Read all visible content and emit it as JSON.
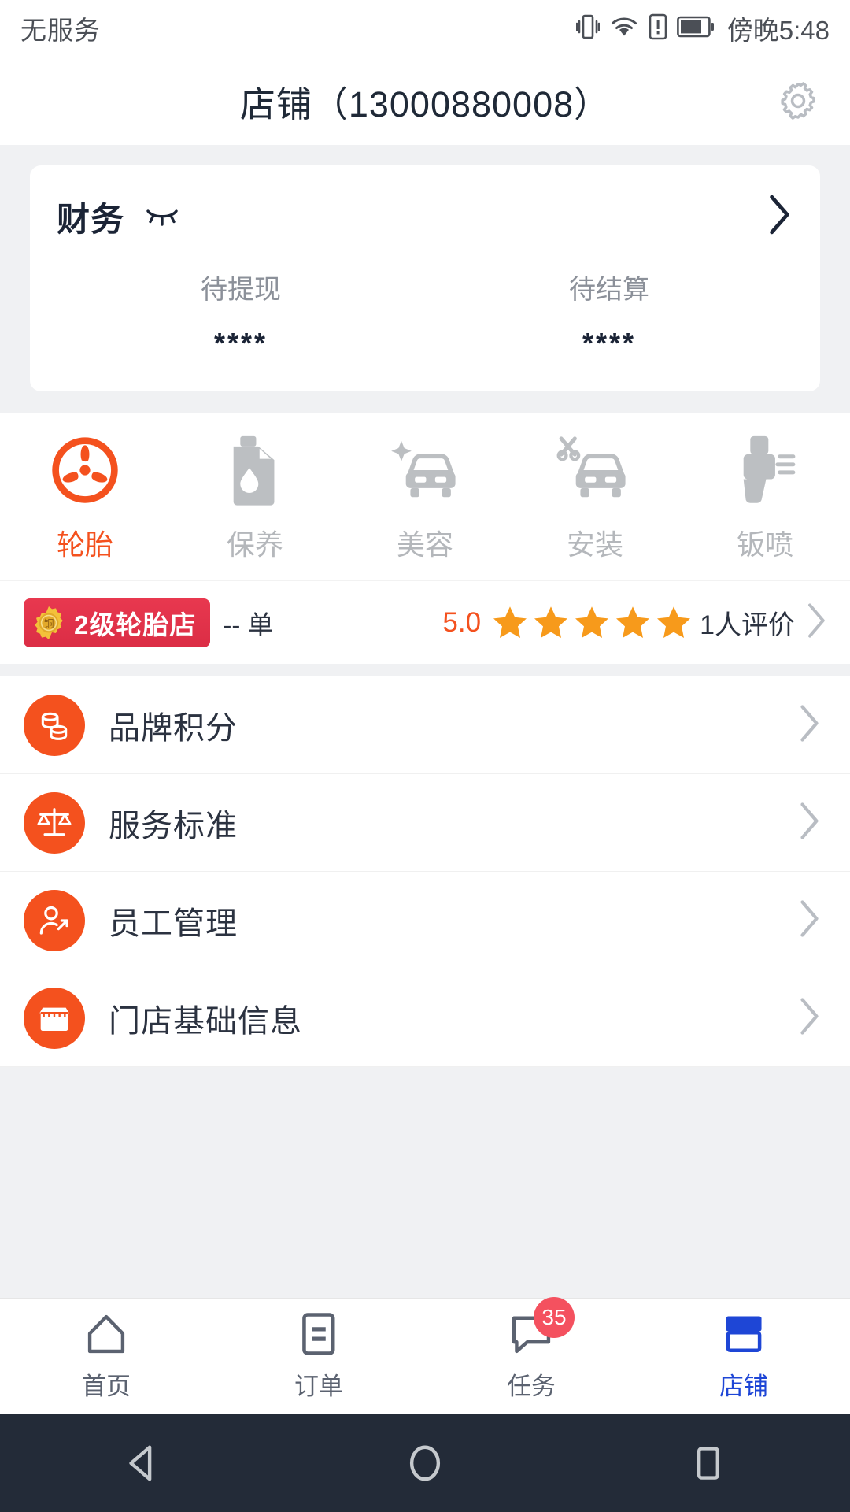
{
  "status_bar": {
    "carrier": "无服务",
    "time": "傍晚5:48",
    "icons": [
      "vibrate-icon",
      "wifi-icon",
      "sim-alert-icon",
      "battery-icon"
    ]
  },
  "header": {
    "title": "店铺（13000880008）",
    "settings_icon": "gear-icon"
  },
  "finance": {
    "title": "财务",
    "visibility_icon": "eye-closed-icon",
    "chevron_icon": "chevron-right-icon",
    "columns": [
      {
        "label": "待提现",
        "value": "****"
      },
      {
        "label": "待结算",
        "value": "****"
      }
    ]
  },
  "categories": [
    {
      "label": "轮胎",
      "icon": "tire-icon",
      "active": true
    },
    {
      "label": "保养",
      "icon": "oil-can-icon",
      "active": false
    },
    {
      "label": "美容",
      "icon": "car-shine-icon",
      "active": false
    },
    {
      "label": "安装",
      "icon": "car-tools-icon",
      "active": false
    },
    {
      "label": "钣喷",
      "icon": "spray-gun-icon",
      "active": false
    }
  ],
  "shop_status": {
    "badge_icon": "bronze-medal-icon",
    "badge_medal_char": "铜",
    "badge_label": "2级轮胎店",
    "order_count": "-- 单",
    "score": "5.0",
    "stars_filled": 5,
    "review_count": "1人评价",
    "chevron_icon": "chevron-right-icon"
  },
  "menu": [
    {
      "label": "品牌积分",
      "icon": "coins-icon",
      "chevron": "chevron-right-icon"
    },
    {
      "label": "服务标准",
      "icon": "scales-icon",
      "chevron": "chevron-right-icon"
    },
    {
      "label": "员工管理",
      "icon": "staff-icon",
      "chevron": "chevron-right-icon"
    },
    {
      "label": "门店基础信息",
      "icon": "storefront-icon",
      "chevron": "chevron-right-icon"
    }
  ],
  "tabbar": [
    {
      "label": "首页",
      "icon": "home-icon",
      "active": false,
      "badge": ""
    },
    {
      "label": "订单",
      "icon": "order-icon",
      "active": false,
      "badge": ""
    },
    {
      "label": "任务",
      "icon": "task-icon",
      "active": false,
      "badge": "35"
    },
    {
      "label": "店铺",
      "icon": "shop-icon",
      "active": true,
      "badge": ""
    }
  ],
  "android_nav": {
    "back": "back-triangle-icon",
    "home": "home-circle-icon",
    "recents": "recents-square-icon"
  },
  "colors": {
    "accent_orange": "#f4511e",
    "badge_red": "#db2d45",
    "active_blue": "#1e46d6",
    "star_orange": "#f79a1b",
    "text_dark": "#2b3240",
    "text_muted": "#8b9099",
    "page_bg": "#f0f1f3"
  }
}
